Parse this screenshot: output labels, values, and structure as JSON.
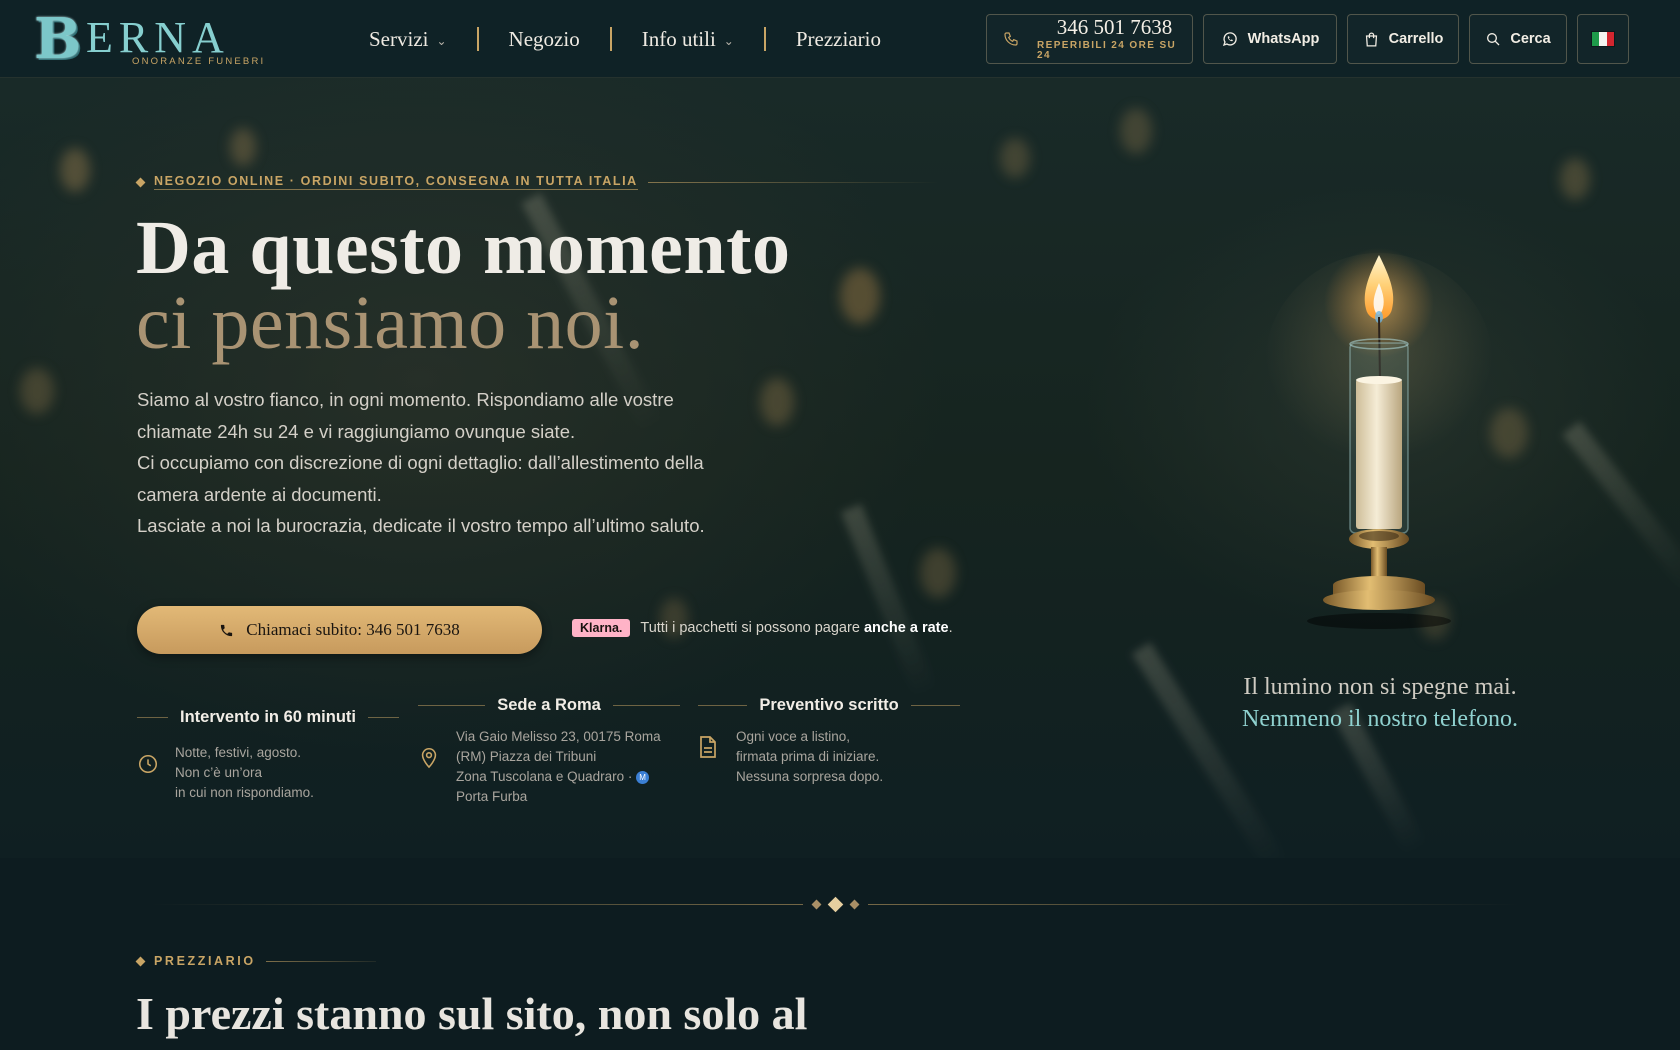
{
  "brand": {
    "logo_letter": "B",
    "logo_word": "ERNA",
    "tagline": "ONORANZE FUNEBRI"
  },
  "nav": {
    "items": [
      {
        "label": "Servizi",
        "has_dropdown": true
      },
      {
        "label": "Negozio",
        "has_dropdown": false
      },
      {
        "label": "Info utili",
        "has_dropdown": true
      },
      {
        "label": "Prezziario",
        "has_dropdown": false
      }
    ]
  },
  "header_actions": {
    "phone_number": "346 501 7638",
    "phone_sub": "REPERIBILI 24 ORE SU 24",
    "whatsapp_label": "WhatsApp",
    "cart_label": "Carrello",
    "search_label": "Cerca",
    "language_flag": "italian-flag"
  },
  "hero": {
    "kicker": "NEGOZIO ONLINE · ORDINI SUBITO, CONSEGNA IN TUTTA ITALIA",
    "title_line1": "Da questo momento",
    "title_line2": "ci pensiamo noi.",
    "lead_lines": [
      "Siamo al vostro fianco, in ogni momento. Rispondiamo alle vostre chiamate 24h su 24 e vi raggiungiamo ovunque siate.",
      "Ci occupiamo con discrezione di ogni dettaglio: dall’allestimento della camera ardente ai documenti.",
      "Lasciate a noi la burocrazia, dedicate il vostro tempo all’ultimo saluto."
    ],
    "cta_label": "Chiamaci subito: 346 501 7638",
    "klarna_badge": "Klarna.",
    "klarna_text": "Tutti i pacchetti si possono pagare ",
    "klarna_bold": "anche a rate",
    "klarna_end": ".",
    "caption_line1": "Il lumino non si spegne mai.",
    "caption_line2": "Nemmeno il nostro telefono."
  },
  "features": [
    {
      "title": "Intervento in 60 minuti",
      "icon": "clock-icon",
      "lines": [
        "Notte, festivi, agosto.",
        "Non c’è un’ora",
        "in cui non rispondiamo."
      ]
    },
    {
      "title": "Sede a Roma",
      "icon": "map-pin-icon",
      "lines": [
        "Via Gaio Melisso 23, 00175 Roma",
        "(RM) Piazza dei Tribuni",
        "Zona Tuscolana e Quadraro ·",
        "Porta Furba"
      ]
    },
    {
      "title": "Preventivo scritto",
      "icon": "document-icon",
      "lines": [
        "Ogni voce a listino,",
        "firmata prima di iniziare.",
        "Nessuna sorpresa dopo."
      ]
    }
  ],
  "section": {
    "kicker": "PREZZIARIO",
    "title": "I prezzi stanno sul sito, non solo al"
  },
  "colors": {
    "accent_gold": "#c9a565",
    "background": "#0d1c20",
    "teal": "#8fd1cf",
    "klarna_pink": "#ffb3c7"
  }
}
